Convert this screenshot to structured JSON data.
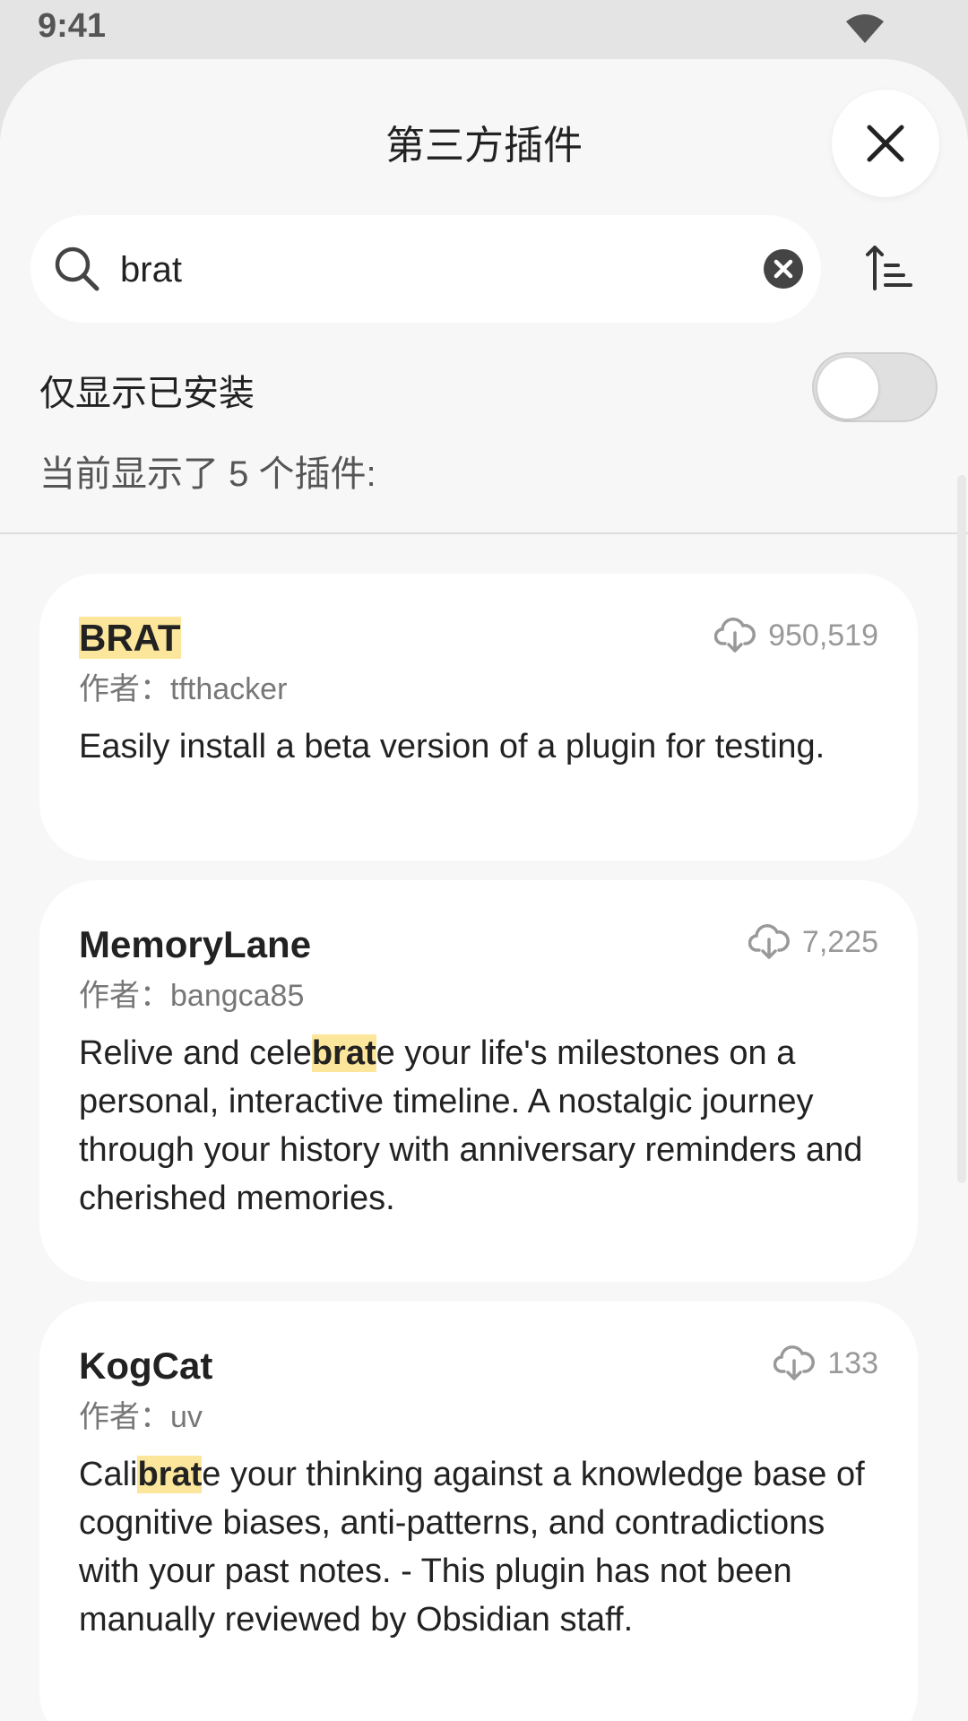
{
  "status": {
    "time": "9:41"
  },
  "sheet": {
    "title": "第三方插件",
    "search": {
      "value": "brat",
      "placeholder": ""
    },
    "filter_label": "仅显示已安装",
    "filter_on": false,
    "count_text": "当前显示了 5 个插件:",
    "author_prefix": "作者：",
    "highlight_color": "#fbe69b"
  },
  "plugins": [
    {
      "title_pre": "",
      "title_hl": "BRAT",
      "title_post": "",
      "downloads": "950,519",
      "author": "tfthacker",
      "desc_pre": "Easily install a beta version of a plugin for testing.",
      "desc_hl": "",
      "desc_post": ""
    },
    {
      "title_pre": "MemoryLane",
      "title_hl": "",
      "title_post": "",
      "downloads": "7,225",
      "author": "bangca85",
      "desc_pre": "Relive and cele",
      "desc_hl": "brat",
      "desc_post": "e your life's milestones on a personal, interactive timeline. A nostalgic journey through your history with anniversary reminders and cherished memories."
    },
    {
      "title_pre": "KogCat",
      "title_hl": "",
      "title_post": "",
      "downloads": "133",
      "author": "uv",
      "desc_pre": "Cali",
      "desc_hl": "brat",
      "desc_post": "e your thinking against a knowledge base of cognitive biases, anti-patterns, and contradictions with your past notes. - This plugin has not been manually reviewed by Obsidian staff."
    }
  ]
}
